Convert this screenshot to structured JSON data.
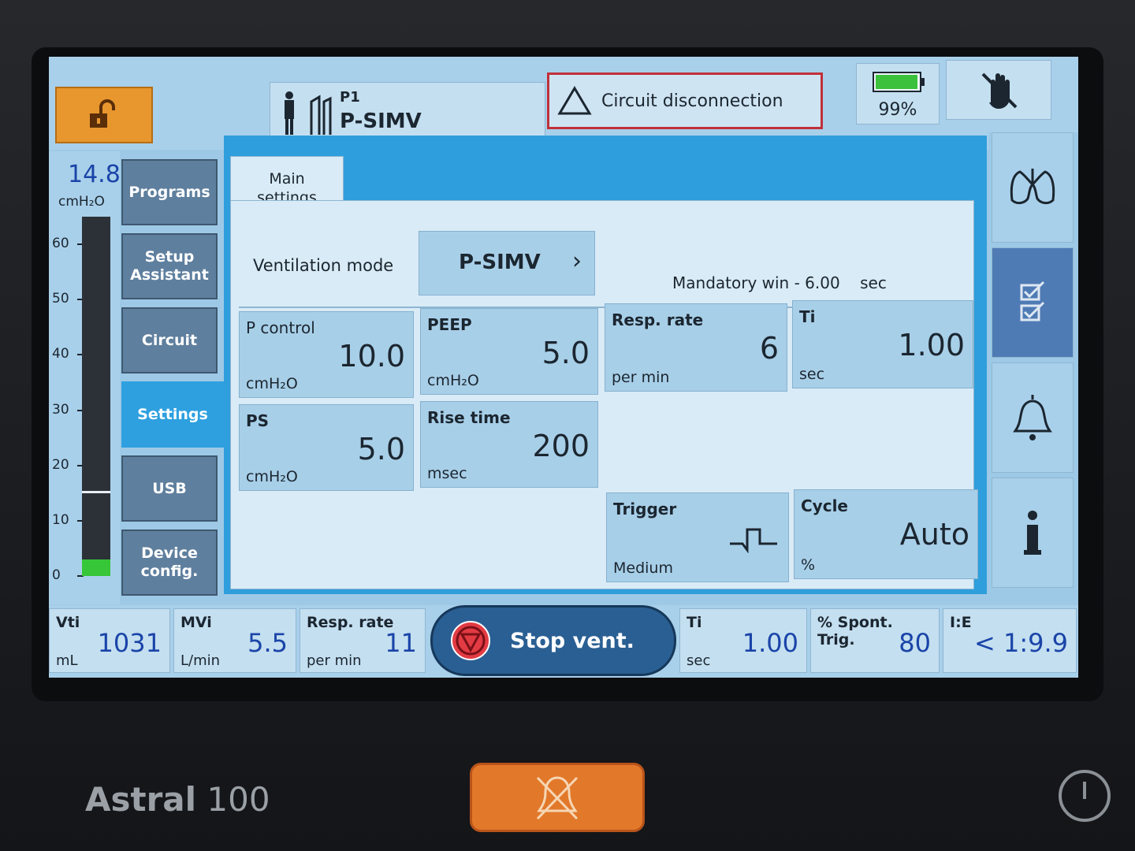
{
  "device": {
    "brand": "Astral",
    "model": "100"
  },
  "header": {
    "program": "P1",
    "mode": "P-SIMV",
    "alarm_message": "Circuit disconnection",
    "battery_percent_label": "99%",
    "battery_level": 0.99
  },
  "gauge": {
    "value": "14.8",
    "unit": "cmH₂O",
    "ticks": [
      "60",
      "50",
      "40",
      "30",
      "20",
      "10",
      "0"
    ],
    "max": 65,
    "fill_level": 3,
    "marker_level": 15
  },
  "nav": {
    "items": [
      {
        "label": "Programs"
      },
      {
        "label": "Setup Assistant"
      },
      {
        "label": "Circuit"
      },
      {
        "label": "Settings"
      },
      {
        "label": "USB"
      },
      {
        "label": "Device config."
      }
    ],
    "active": "Settings"
  },
  "main": {
    "tab_label": "Main settings",
    "ventilation_mode_label": "Ventilation mode",
    "ventilation_mode_value": "P-SIMV",
    "mandatory_window": "Mandatory win - 6.00    sec",
    "tiles": {
      "p_control": {
        "title": "P control",
        "value": "10.0",
        "unit": "cmH₂O"
      },
      "peep": {
        "title": "PEEP",
        "value": "5.0",
        "unit": "cmH₂O"
      },
      "resp_rate": {
        "title": "Resp. rate",
        "value": "6",
        "unit": "per min"
      },
      "ti": {
        "title": "Ti",
        "value": "1.00",
        "unit": "sec"
      },
      "ps": {
        "title": "PS",
        "value": "5.0",
        "unit": "cmH₂O"
      },
      "rise_time": {
        "title": "Rise time",
        "value": "200",
        "unit": "msec"
      },
      "trigger": {
        "title": "Trigger",
        "value": "Medium"
      },
      "cycle": {
        "title": "Cycle",
        "value": "Auto",
        "unit": "%"
      }
    }
  },
  "monitor": {
    "vti": {
      "title": "Vti",
      "value": "1031",
      "unit": "mL"
    },
    "mvi": {
      "title": "MVi",
      "value": "5.5",
      "unit": "L/min"
    },
    "resp_rate": {
      "title": "Resp. rate",
      "value": "11",
      "unit": "per min"
    },
    "stop_label": "Stop vent.",
    "ti": {
      "title": "Ti",
      "value": "1.00",
      "unit": "sec"
    },
    "spont": {
      "title": "% Spont. Trig.",
      "value": "80"
    },
    "ie": {
      "title": "I:E",
      "value": "< 1:9.9"
    }
  },
  "colors": {
    "accent": "#2ea0e0",
    "alarm": "#c0303a",
    "unlock": "#e8962e",
    "value_blue": "#1a44a8"
  }
}
